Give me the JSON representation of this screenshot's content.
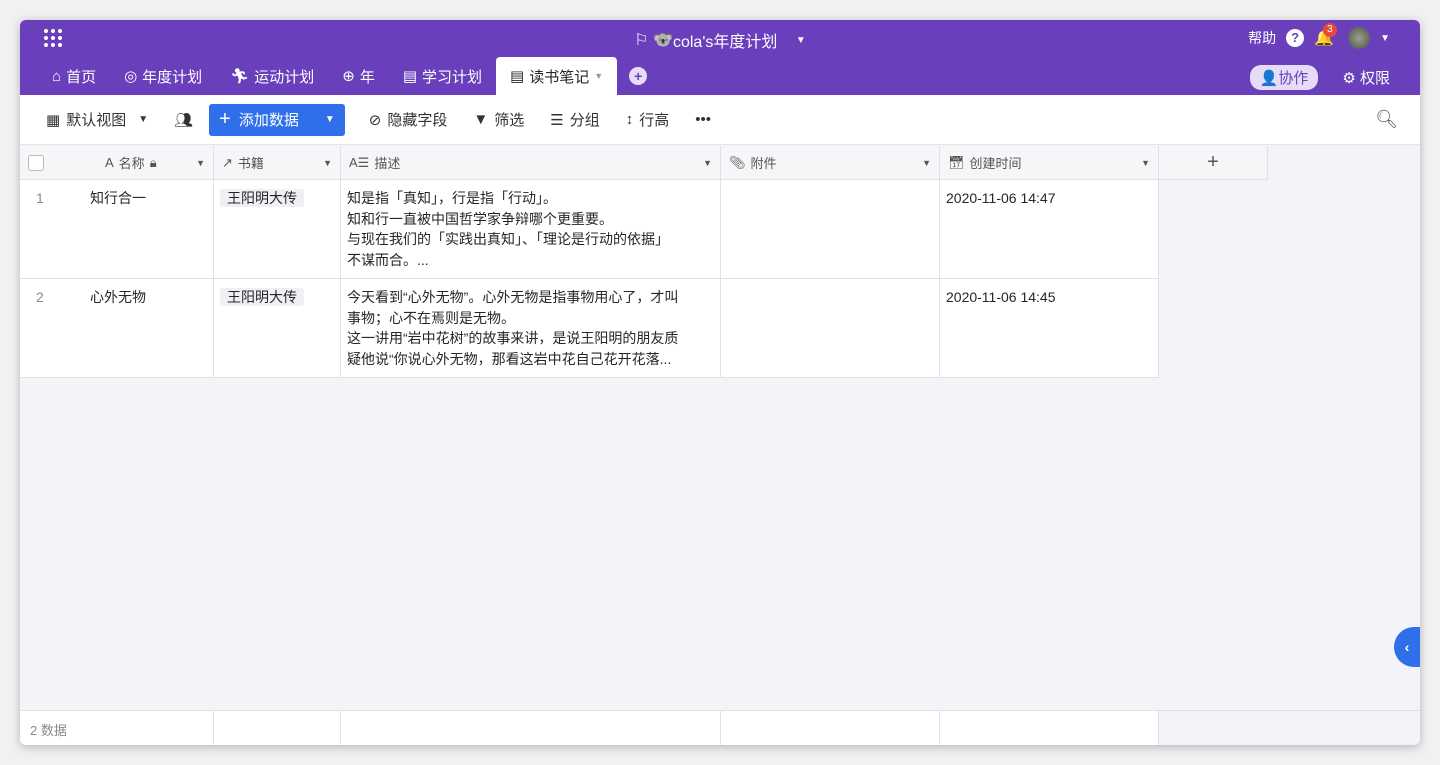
{
  "header": {
    "title": "cola's年度计划",
    "help": "帮助",
    "notification_count": "3"
  },
  "tabs": [
    {
      "label": "首页",
      "icon": "home-icon"
    },
    {
      "label": "年度计划",
      "icon": "target-icon"
    },
    {
      "label": "运动计划",
      "icon": "runner-icon"
    },
    {
      "label": "年",
      "icon": "globe-icon"
    },
    {
      "label": "学习计划",
      "icon": "book-icon"
    },
    {
      "label": "读书笔记",
      "icon": "book-icon"
    }
  ],
  "tab_actions": {
    "collab": "协作",
    "permission": "权限"
  },
  "toolbar": {
    "view": "默认视图",
    "add": "添加数据",
    "hide": "隐藏字段",
    "filter": "筛选",
    "group": "分组",
    "row_height": "行高"
  },
  "columns": [
    "名称",
    "书籍",
    "描述",
    "附件",
    "创建时间"
  ],
  "rows": [
    {
      "num": "1",
      "name": "知行合一",
      "book": "王阳明大传",
      "desc": [
        "知是指「真知」，行是指「行动」。",
        "知和行一直被中国哲学家争辩哪个更重要。",
        "与现在我们的「实践出真知」、「理论是行动的依据」",
        "不谋而合。..."
      ],
      "created": "2020-11-06 14:47"
    },
    {
      "num": "2",
      "name": "心外无物",
      "book": "王阳明大传",
      "desc": [
        "今天看到“心外无物”。心外无物是指事物用心了，才叫",
        "事物；心不在焉则是无物。",
        "这一讲用“岩中花树”的故事来讲，是说王阳明的朋友质",
        "疑他说“你说心外无物，那看这岩中花自己花开花落..."
      ],
      "created": "2020-11-06 14:45"
    }
  ],
  "footer": {
    "count": "2 数据"
  }
}
